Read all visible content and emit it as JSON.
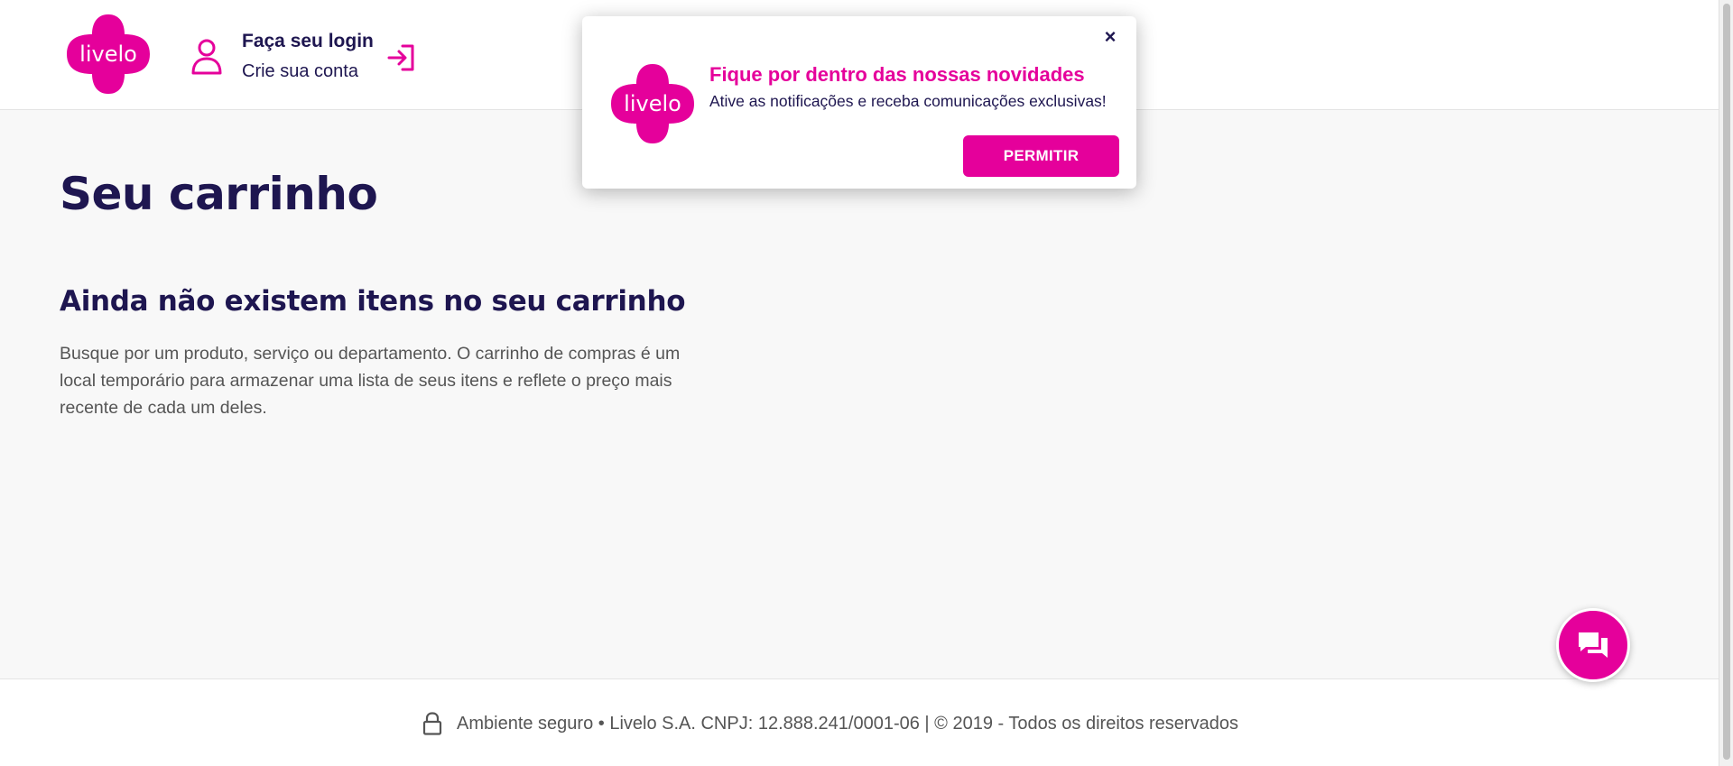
{
  "brand": {
    "logo_text": "livelo",
    "primary_color": "#e5009b",
    "navy_color": "#1e1650"
  },
  "header": {
    "login_label": "Faça seu login",
    "signup_label": "Crie sua conta",
    "user_icon": "user-icon",
    "enter_icon": "sign-in-icon"
  },
  "main": {
    "title": "Seu carrinho",
    "empty_title": "Ainda não existem itens no seu carrinho",
    "empty_description": "Busque por um produto, serviço ou departamento. O carrinho de compras é um local temporário para armazenar uma lista de seus itens e reflete o preço mais recente de cada um deles."
  },
  "footer": {
    "lock_icon": "lock-icon",
    "text": "Ambiente seguro • Livelo S.A. CNPJ: 12.888.241/0001-06 | © 2019 - Todos os direitos reservados"
  },
  "popup": {
    "close_label": "×",
    "title": "Fique por dentro das nossas novidades",
    "subtitle": "Ative as notificações e receba comunicações exclusivas!",
    "button_label": "PERMITIR"
  },
  "chat": {
    "icon": "chat-icon"
  }
}
